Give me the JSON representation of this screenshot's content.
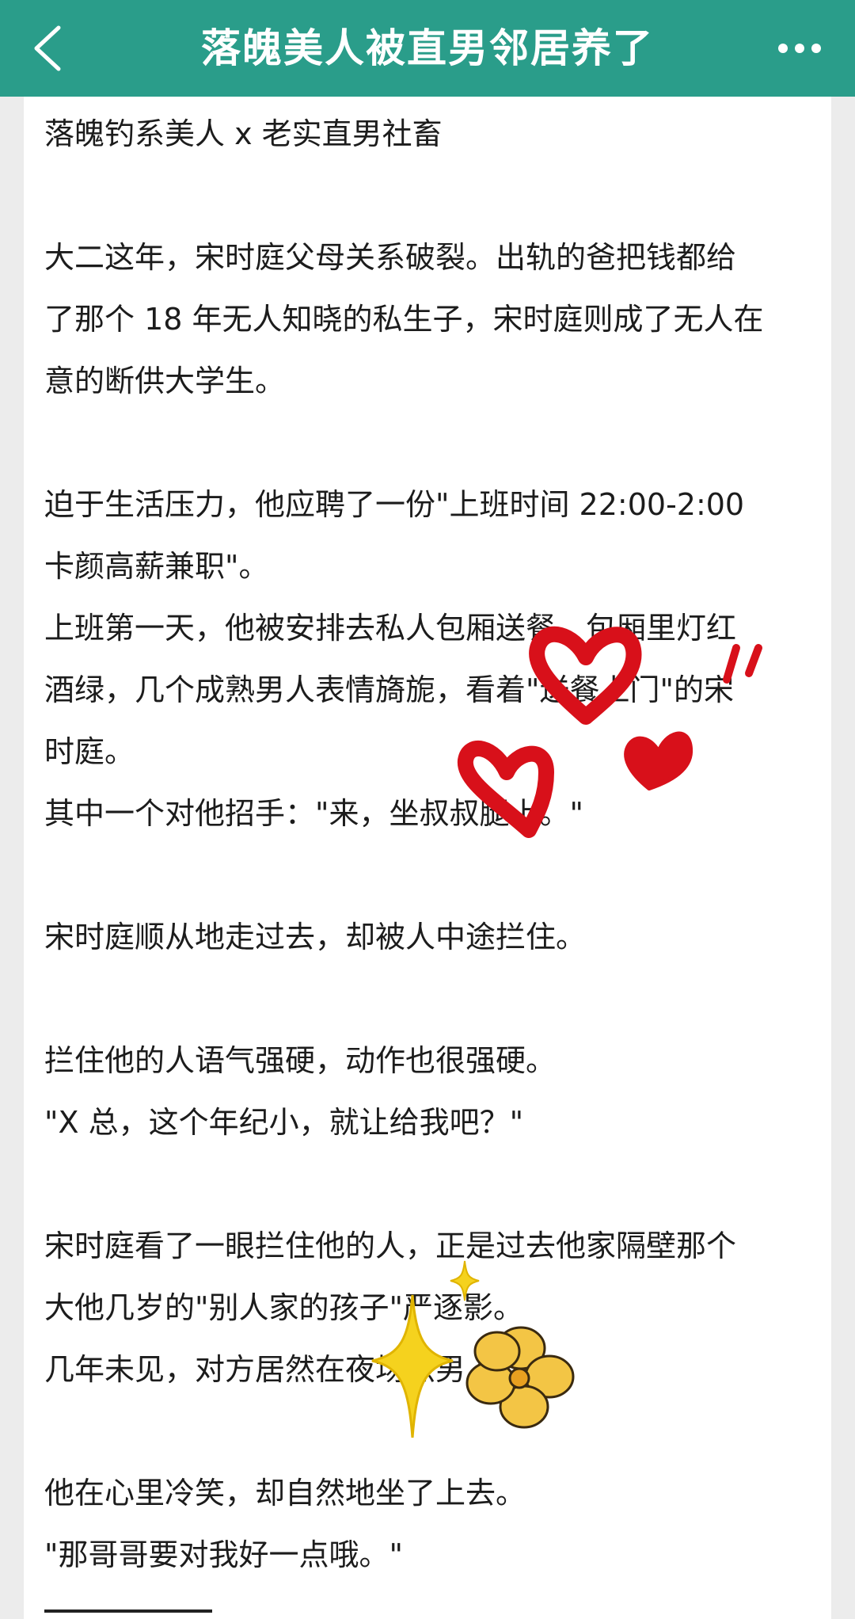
{
  "header": {
    "title": "落魄美人被直男邻居养了",
    "back_icon": "chevron-left-icon",
    "more_icon": "more-dots-icon",
    "bar_color": "#2a9d8a"
  },
  "article": {
    "paragraphs": [
      "落魄钓系美人 x 老实直男社畜",
      "",
      "大二这年，宋时庭父母关系破裂。出轨的爸把钱都给",
      "了那个 18 年无人知晓的私生子，宋时庭则成了无人在",
      "意的断供大学生。",
      "",
      "迫于生活压力，他应聘了一份\"上班时间 22:00-2:00",
      "卡颜高薪兼职\"。",
      "上班第一天，他被安排去私人包厢送餐。包厢里灯红",
      "酒绿，几个成熟男人表情旖旎，看着\"送餐上门\"的宋",
      "时庭。",
      "其中一个对他招手：\"来，坐叔叔腿上。\"",
      "",
      "宋时庭顺从地走过去，却被人中途拦住。",
      "",
      "拦住他的人语气强硬，动作也很强硬。",
      "\"X 总，这个年纪小，就让给我吧？\"",
      "",
      "宋时庭看了一眼拦住他的人，正是过去他家隔壁那个",
      "大他几岁的\"别人家的孩子\"严逐影。",
      "几年未见，对方居然在夜场点男人。",
      "",
      "他在心里冷笑，却自然地坐了上去。",
      "\"那哥哥要对我好一点哦。\""
    ]
  },
  "stickers": {
    "heart_color": "#d8101a",
    "sparkle_color": "#f5d21e",
    "flower_color": "#f3c545",
    "icons": [
      "heart-sticker-icon",
      "sparkle-sticker-icon",
      "flower-sticker-icon"
    ]
  }
}
